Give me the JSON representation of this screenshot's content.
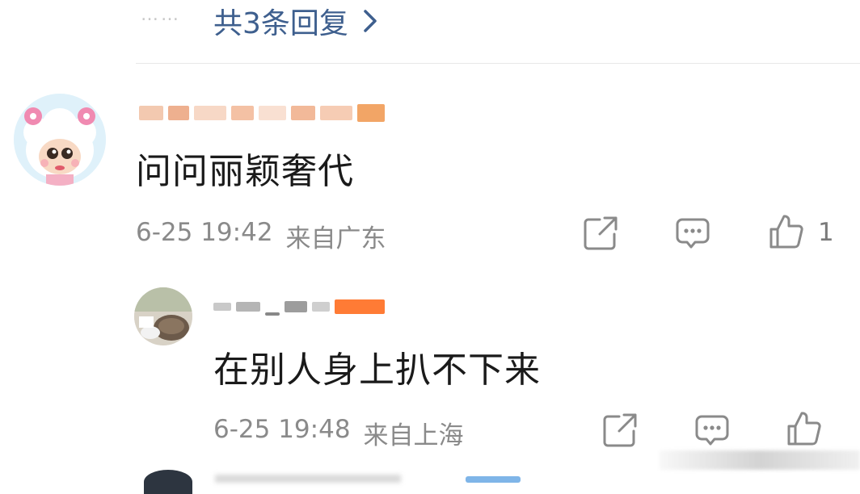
{
  "thread": {
    "dots": "……",
    "replies_label": "共3条回复"
  },
  "comment": {
    "text": "问问丽颖奢代",
    "time": "6-25 19:42",
    "location": "来自广东",
    "like_count": "1"
  },
  "reply": {
    "text": "在别人身上扒不下来",
    "time": "6-25 19:48",
    "location": "来自上海"
  },
  "icons": {
    "share": "share-icon",
    "comment": "comment-icon",
    "like": "thumbs-up-icon",
    "chevron": "chevron-right-icon"
  },
  "colors": {
    "link": "#3e5f8e",
    "meta": "#8a8a8a",
    "badge": "#ff7b35"
  }
}
